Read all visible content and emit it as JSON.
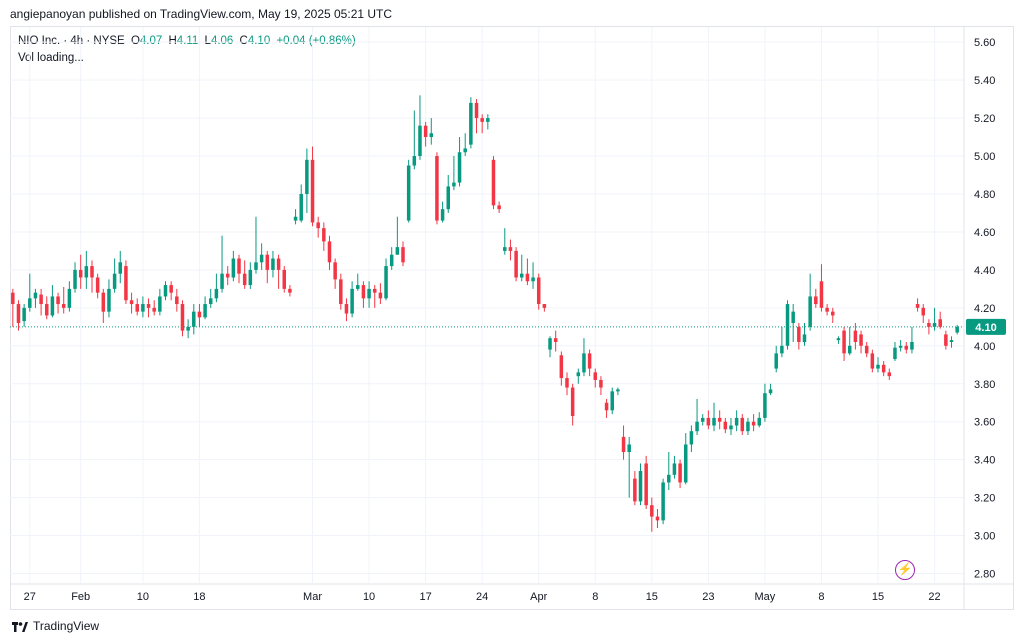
{
  "header": {
    "published": "angiepanoyan published on TradingView.com, May 19, 2025 05:21 UTC"
  },
  "legend": {
    "symbol": "NIO Inc. · 4h · NYSE",
    "open_label": "O",
    "open": "4.07",
    "high_label": "H",
    "high": "4.11",
    "low_label": "L",
    "low": "4.06",
    "close_label": "C",
    "close": "4.10",
    "change": "+0.04 (+0.86%)",
    "volume": "Vol loading..."
  },
  "footer": {
    "brand": "TradingView"
  },
  "colors": {
    "up": "#089981",
    "down": "#f23645",
    "grid": "#f0f3fa",
    "last_price": "#089981"
  },
  "chart_data": {
    "type": "candlestick",
    "title": "NIO Inc. · 4h · NYSE",
    "ylim": [
      2.75,
      5.68
    ],
    "y_ticks": [
      "5.60",
      "5.40",
      "5.20",
      "5.00",
      "4.80",
      "4.60",
      "4.40",
      "4.20",
      "4.00",
      "3.80",
      "3.60",
      "3.40",
      "3.20",
      "3.00",
      "2.80"
    ],
    "x_ticks": [
      "27",
      "Feb",
      "10",
      "18",
      "Mar",
      "10",
      "17",
      "24",
      "Apr",
      "8",
      "15",
      "23",
      "May",
      "8",
      "15",
      "22"
    ],
    "x_tick_index": [
      3,
      12,
      23,
      33,
      53,
      63,
      73,
      83,
      93,
      103,
      113,
      123,
      133,
      143,
      153,
      163
    ],
    "last_price": 4.1,
    "last_price_label": "4.10",
    "candles": [
      [
        4.28,
        4.22,
        4.3,
        4.1
      ],
      [
        4.22,
        4.12,
        4.24,
        4.08
      ],
      [
        4.13,
        4.2,
        4.22,
        4.1
      ],
      [
        4.2,
        4.25,
        4.38,
        4.18
      ],
      [
        4.25,
        4.28,
        4.3,
        4.2
      ],
      [
        4.27,
        4.22,
        4.3,
        4.16
      ],
      [
        4.22,
        4.16,
        4.26,
        4.14
      ],
      [
        4.16,
        4.26,
        4.32,
        4.15
      ],
      [
        4.26,
        4.22,
        4.28,
        4.17
      ],
      [
        4.22,
        4.2,
        4.31,
        4.17
      ],
      [
        4.2,
        4.3,
        4.34,
        4.18
      ],
      [
        4.3,
        4.4,
        4.44,
        4.28
      ],
      [
        4.4,
        4.36,
        4.48,
        4.3
      ],
      [
        4.36,
        4.42,
        4.5,
        4.3
      ],
      [
        4.42,
        4.36,
        4.45,
        4.28
      ],
      [
        4.36,
        4.28,
        4.38,
        4.25
      ],
      [
        4.28,
        4.18,
        4.3,
        4.12
      ],
      [
        4.18,
        4.3,
        4.35,
        4.15
      ],
      [
        4.3,
        4.38,
        4.46,
        4.28
      ],
      [
        4.38,
        4.44,
        4.5,
        4.33
      ],
      [
        4.42,
        4.24,
        4.45,
        4.22
      ],
      [
        4.24,
        4.22,
        4.28,
        4.17
      ],
      [
        4.22,
        4.18,
        4.25,
        4.16
      ],
      [
        4.18,
        4.22,
        4.26,
        4.15
      ],
      [
        4.22,
        4.2,
        4.25,
        4.15
      ],
      [
        4.2,
        4.18,
        4.24,
        4.16
      ],
      [
        4.18,
        4.26,
        4.3,
        4.16
      ],
      [
        4.26,
        4.32,
        4.34,
        4.24
      ],
      [
        4.32,
        4.28,
        4.34,
        4.24
      ],
      [
        4.26,
        4.22,
        4.3,
        4.18
      ],
      [
        4.22,
        4.08,
        4.24,
        4.05
      ],
      [
        4.08,
        4.1,
        4.14,
        4.04
      ],
      [
        4.1,
        4.18,
        4.22,
        4.06
      ],
      [
        4.18,
        4.15,
        4.22,
        4.1
      ],
      [
        4.15,
        4.22,
        4.26,
        4.14
      ],
      [
        4.22,
        4.25,
        4.3,
        4.2
      ],
      [
        4.25,
        4.3,
        4.38,
        4.23
      ],
      [
        4.3,
        4.38,
        4.58,
        4.28
      ],
      [
        4.38,
        4.36,
        4.42,
        4.32
      ],
      [
        4.36,
        4.46,
        4.5,
        4.34
      ],
      [
        4.46,
        4.38,
        4.48,
        4.33
      ],
      [
        4.38,
        4.32,
        4.45,
        4.3
      ],
      [
        4.32,
        4.4,
        4.44,
        4.3
      ],
      [
        4.4,
        4.44,
        4.68,
        4.38
      ],
      [
        4.44,
        4.48,
        4.54,
        4.4
      ],
      [
        4.48,
        4.4,
        4.5,
        4.33
      ],
      [
        4.4,
        4.46,
        4.5,
        4.36
      ],
      [
        4.46,
        4.4,
        4.48,
        4.3
      ],
      [
        4.4,
        4.3,
        4.42,
        4.28
      ],
      [
        4.3,
        4.28,
        4.32,
        4.26
      ],
      [
        4.66,
        4.68,
        4.72,
        4.64
      ],
      [
        4.66,
        4.8,
        4.85,
        4.65
      ],
      [
        4.8,
        4.98,
        5.04,
        4.7
      ],
      [
        4.98,
        4.65,
        5.05,
        4.63
      ],
      [
        4.65,
        4.62,
        4.68,
        4.57
      ],
      [
        4.62,
        4.55,
        4.65,
        4.5
      ],
      [
        4.55,
        4.44,
        4.58,
        4.4
      ],
      [
        4.44,
        4.35,
        4.46,
        4.3
      ],
      [
        4.35,
        4.22,
        4.38,
        4.19
      ],
      [
        4.22,
        4.17,
        4.25,
        4.13
      ],
      [
        4.17,
        4.3,
        4.34,
        4.15
      ],
      [
        4.3,
        4.32,
        4.38,
        4.29
      ],
      [
        4.32,
        4.25,
        4.34,
        4.2
      ],
      [
        4.25,
        4.3,
        4.34,
        4.2
      ],
      [
        4.3,
        4.28,
        4.32,
        4.2
      ],
      [
        4.28,
        4.25,
        4.33,
        4.22
      ],
      [
        4.25,
        4.42,
        4.46,
        4.24
      ],
      [
        4.42,
        4.48,
        4.52,
        4.4
      ],
      [
        4.48,
        4.52,
        4.68,
        4.48
      ],
      [
        4.52,
        4.44,
        4.55,
        4.42
      ],
      [
        4.66,
        4.95,
        4.98,
        4.65
      ],
      [
        4.95,
        5.0,
        5.24,
        4.93
      ],
      [
        5.0,
        5.16,
        5.32,
        4.98
      ],
      [
        5.16,
        5.1,
        5.18,
        5.05
      ],
      [
        5.1,
        5.12,
        5.2,
        5.06
      ],
      [
        5.0,
        4.66,
        5.02,
        4.64
      ],
      [
        4.66,
        4.72,
        4.76,
        4.65
      ],
      [
        4.72,
        4.84,
        4.9,
        4.7
      ],
      [
        4.84,
        4.86,
        5.0,
        4.82
      ],
      [
        4.86,
        5.02,
        5.1,
        4.84
      ],
      [
        5.02,
        5.04,
        5.12,
        5.0
      ],
      [
        5.06,
        5.28,
        5.31,
        5.04
      ],
      [
        5.28,
        5.2,
        5.3,
        5.12
      ],
      [
        5.2,
        5.18,
        5.22,
        5.12
      ],
      [
        5.18,
        5.2,
        5.22,
        5.14
      ],
      [
        4.98,
        4.74,
        5.0,
        4.72
      ],
      [
        4.74,
        4.72,
        4.76,
        4.7
      ],
      [
        4.5,
        4.52,
        4.62,
        4.48
      ],
      [
        4.52,
        4.5,
        4.56,
        4.45
      ],
      [
        4.5,
        4.36,
        4.52,
        4.34
      ],
      [
        4.36,
        4.38,
        4.48,
        4.34
      ],
      [
        4.38,
        4.34,
        4.46,
        4.32
      ],
      [
        4.34,
        4.36,
        4.44,
        4.3
      ],
      [
        4.36,
        4.22,
        4.38,
        4.19
      ],
      [
        4.22,
        4.2,
        4.22,
        4.18
      ],
      [
        3.98,
        4.04,
        4.05,
        3.94
      ],
      [
        4.04,
        4.02,
        4.08,
        3.97
      ],
      [
        3.95,
        3.83,
        3.97,
        3.79
      ],
      [
        3.83,
        3.78,
        3.86,
        3.74
      ],
      [
        3.78,
        3.63,
        3.8,
        3.58
      ],
      [
        3.84,
        3.86,
        3.88,
        3.8
      ],
      [
        3.86,
        3.96,
        4.04,
        3.84
      ],
      [
        3.96,
        3.88,
        3.98,
        3.84
      ],
      [
        3.86,
        3.82,
        3.88,
        3.78
      ],
      [
        3.82,
        3.78,
        3.84,
        3.74
      ],
      [
        3.7,
        3.66,
        3.72,
        3.62
      ],
      [
        3.66,
        3.76,
        3.78,
        3.64
      ],
      [
        3.76,
        3.77,
        3.78,
        3.74
      ],
      [
        3.52,
        3.44,
        3.58,
        3.4
      ],
      [
        3.44,
        3.48,
        3.52,
        3.2
      ],
      [
        3.3,
        3.18,
        3.34,
        3.16
      ],
      [
        3.18,
        3.34,
        3.38,
        3.16
      ],
      [
        3.38,
        3.16,
        3.42,
        3.14
      ],
      [
        3.16,
        3.1,
        3.2,
        3.02
      ],
      [
        3.1,
        3.08,
        3.14,
        3.04
      ],
      [
        3.08,
        3.28,
        3.3,
        3.06
      ],
      [
        3.28,
        3.32,
        3.44,
        3.24
      ],
      [
        3.32,
        3.38,
        3.42,
        3.3
      ],
      [
        3.38,
        3.28,
        3.4,
        3.25
      ],
      [
        3.28,
        3.48,
        3.54,
        3.27
      ],
      [
        3.48,
        3.55,
        3.58,
        3.44
      ],
      [
        3.55,
        3.6,
        3.72,
        3.53
      ],
      [
        3.6,
        3.62,
        3.64,
        3.58
      ],
      [
        3.62,
        3.58,
        3.66,
        3.56
      ],
      [
        3.58,
        3.62,
        3.7,
        3.55
      ],
      [
        3.62,
        3.6,
        3.66,
        3.56
      ],
      [
        3.6,
        3.56,
        3.62,
        3.54
      ],
      [
        3.56,
        3.58,
        3.62,
        3.53
      ],
      [
        3.58,
        3.62,
        3.66,
        3.55
      ],
      [
        3.62,
        3.55,
        3.64,
        3.53
      ],
      [
        3.55,
        3.6,
        3.62,
        3.53
      ],
      [
        3.6,
        3.58,
        3.64,
        3.55
      ],
      [
        3.58,
        3.62,
        3.65,
        3.57
      ],
      [
        3.62,
        3.75,
        3.8,
        3.6
      ],
      [
        3.75,
        3.77,
        3.8,
        3.74
      ],
      [
        3.88,
        3.96,
        4.0,
        3.86
      ],
      [
        3.96,
        4.0,
        4.1,
        3.94
      ],
      [
        4.0,
        4.22,
        4.24,
        3.98
      ],
      [
        4.12,
        4.18,
        4.22,
        4.02
      ],
      [
        4.1,
        4.02,
        4.12,
        3.98
      ],
      [
        4.02,
        4.06,
        4.12,
        4.0
      ],
      [
        4.1,
        4.26,
        4.38,
        4.08
      ],
      [
        4.26,
        4.22,
        4.3,
        4.2
      ],
      [
        4.34,
        4.2,
        4.43,
        4.18
      ],
      [
        4.2,
        4.18,
        4.22,
        4.16
      ],
      [
        4.18,
        4.16,
        4.2,
        4.12
      ],
      [
        4.03,
        4.04,
        4.05,
        4.01
      ],
      [
        4.08,
        3.96,
        4.1,
        3.92
      ],
      [
        3.96,
        4.0,
        4.1,
        3.95
      ],
      [
        4.08,
        4.02,
        4.12,
        3.98
      ],
      [
        4.06,
        4.0,
        4.08,
        3.96
      ],
      [
        4.0,
        3.96,
        4.02,
        3.94
      ],
      [
        3.96,
        3.88,
        3.98,
        3.86
      ],
      [
        3.88,
        3.9,
        3.94,
        3.86
      ],
      [
        3.9,
        3.86,
        3.92,
        3.84
      ],
      [
        3.86,
        3.84,
        3.88,
        3.82
      ],
      [
        3.93,
        3.99,
        4.02,
        3.92
      ],
      [
        3.99,
        4.0,
        4.03,
        3.97
      ],
      [
        4.0,
        3.98,
        4.02,
        3.96
      ],
      [
        3.98,
        4.02,
        4.1,
        3.96
      ],
      [
        4.22,
        4.2,
        4.25,
        4.18
      ],
      [
        4.2,
        4.16,
        4.22,
        4.12
      ],
      [
        4.12,
        4.1,
        4.14,
        4.06
      ],
      [
        4.1,
        4.12,
        4.2,
        4.08
      ],
      [
        4.14,
        4.1,
        4.18,
        4.09
      ],
      [
        4.06,
        4.0,
        4.08,
        3.98
      ],
      [
        4.02,
        4.03,
        4.05,
        3.99
      ],
      [
        4.07,
        4.1,
        4.11,
        4.06
      ]
    ]
  }
}
